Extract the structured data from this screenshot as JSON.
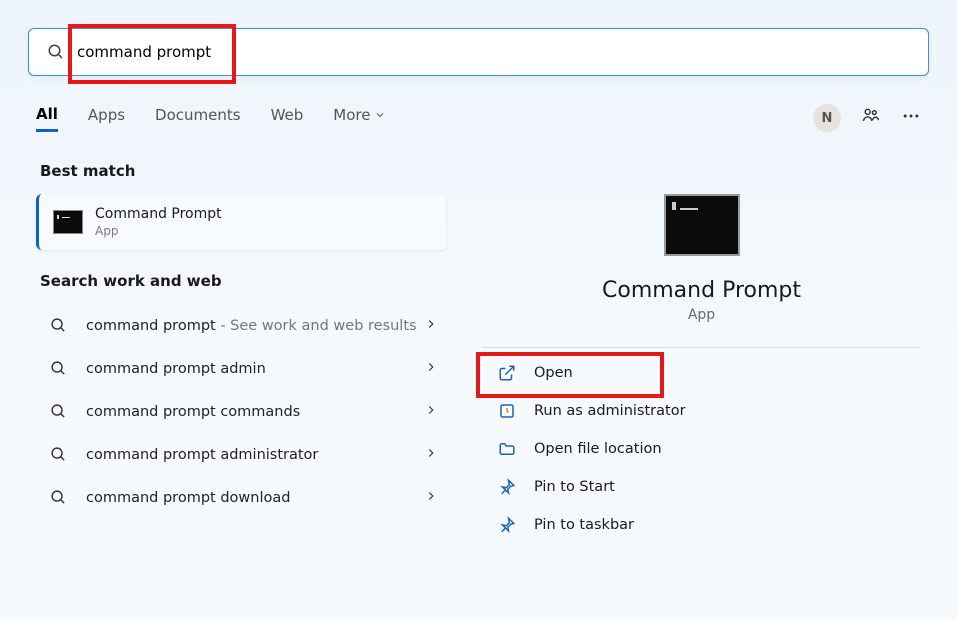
{
  "search": {
    "query": "command prompt"
  },
  "tabs": {
    "all": "All",
    "apps": "Apps",
    "documents": "Documents",
    "web": "Web",
    "more": "More"
  },
  "avatar_letter": "N",
  "left": {
    "best_match_label": "Best match",
    "best": {
      "title": "Command Prompt",
      "subtitle": "App"
    },
    "work_web_label": "Search work and web",
    "suggestions": [
      {
        "text": "command prompt",
        "suffix": " - See work and web results"
      },
      {
        "text": "command prompt admin",
        "suffix": ""
      },
      {
        "text": "command prompt commands",
        "suffix": ""
      },
      {
        "text": "command prompt administrator",
        "suffix": ""
      },
      {
        "text": "command prompt download",
        "suffix": ""
      }
    ]
  },
  "right": {
    "title": "Command Prompt",
    "subtitle": "App",
    "actions": {
      "open": "Open",
      "runadmin": "Run as administrator",
      "openloc": "Open file location",
      "pinstart": "Pin to Start",
      "pintaskbar": "Pin to taskbar"
    }
  }
}
